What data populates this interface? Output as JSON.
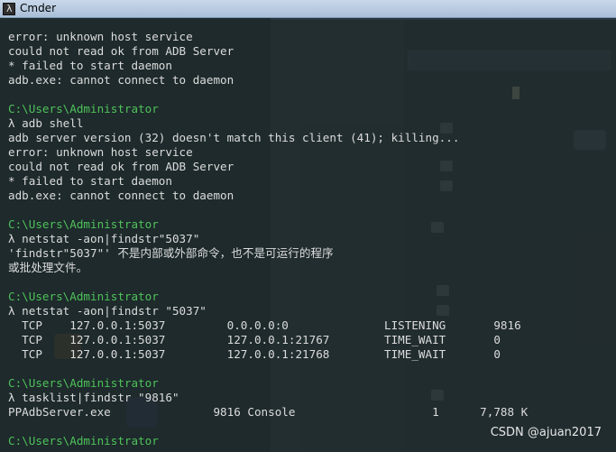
{
  "window": {
    "title": "Cmder"
  },
  "console": {
    "lines": [
      {
        "text": "error: unknown host service",
        "kind": "output"
      },
      {
        "text": "could not read ok from ADB Server",
        "kind": "output"
      },
      {
        "text": "* failed to start daemon",
        "kind": "output"
      },
      {
        "text": "adb.exe: cannot connect to daemon",
        "kind": "output"
      },
      {
        "text": "",
        "kind": "blank"
      },
      {
        "text": "C:\\Users\\Administrator",
        "kind": "prompt"
      },
      {
        "text": "λ adb shell",
        "kind": "command"
      },
      {
        "text": "adb server version (32) doesn't match this client (41); killing...",
        "kind": "output"
      },
      {
        "text": "error: unknown host service",
        "kind": "output"
      },
      {
        "text": "could not read ok from ADB Server",
        "kind": "output"
      },
      {
        "text": "* failed to start daemon",
        "kind": "output"
      },
      {
        "text": "adb.exe: cannot connect to daemon",
        "kind": "output"
      },
      {
        "text": "",
        "kind": "blank"
      },
      {
        "text": "C:\\Users\\Administrator",
        "kind": "prompt"
      },
      {
        "text": "λ netstat -aon|findstr\"5037\"",
        "kind": "command"
      },
      {
        "text": "'findstr\"5037\"' 不是内部或外部命令，也不是可运行的程序",
        "kind": "output"
      },
      {
        "text": "或批处理文件。",
        "kind": "output"
      },
      {
        "text": "",
        "kind": "blank"
      },
      {
        "text": "C:\\Users\\Administrator",
        "kind": "prompt"
      },
      {
        "text": "λ netstat -aon|findstr \"5037\"",
        "kind": "command"
      },
      {
        "text": "  TCP    127.0.0.1:5037         0.0.0.0:0              LISTENING       9816",
        "kind": "output"
      },
      {
        "text": "  TCP    127.0.0.1:5037         127.0.0.1:21767        TIME_WAIT       0",
        "kind": "output"
      },
      {
        "text": "  TCP    127.0.0.1:5037         127.0.0.1:21768        TIME_WAIT       0",
        "kind": "output"
      },
      {
        "text": "",
        "kind": "blank"
      },
      {
        "text": "C:\\Users\\Administrator",
        "kind": "prompt"
      },
      {
        "text": "λ tasklist|findstr \"9816\"",
        "kind": "command"
      },
      {
        "text": "PPAdbServer.exe               9816 Console                    1      7,788 K",
        "kind": "output"
      },
      {
        "text": "",
        "kind": "blank"
      },
      {
        "text": "C:\\Users\\Administrator",
        "kind": "prompt"
      }
    ]
  },
  "watermark": "CSDN @ajuan2017",
  "colors": {
    "prompt": "#4ec25a",
    "text": "#dcdcdc",
    "background": "#202a2c"
  }
}
